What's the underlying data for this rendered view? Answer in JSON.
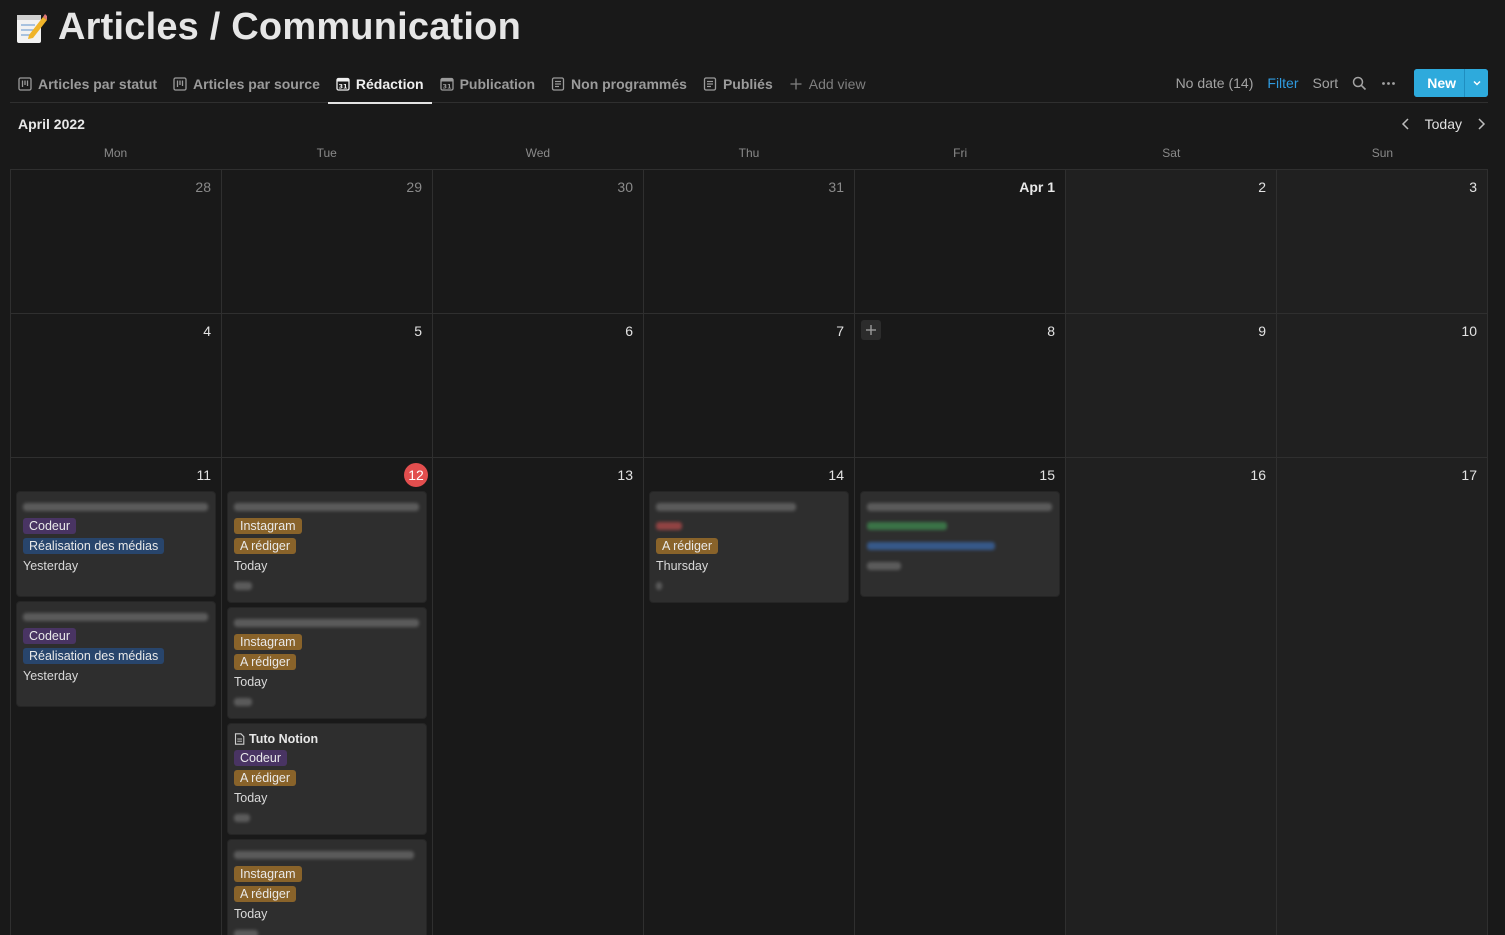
{
  "page": {
    "emoji": "memo-icon",
    "title": "Articles / Communication"
  },
  "views": [
    {
      "label": "Articles par statut",
      "icon": "board-icon",
      "active": false
    },
    {
      "label": "Articles par source",
      "icon": "board-icon",
      "active": false
    },
    {
      "label": "Rédaction",
      "icon": "calendar-icon",
      "active": true
    },
    {
      "label": "Publication",
      "icon": "calendar-icon",
      "active": false
    },
    {
      "label": "Non programmés",
      "icon": "list-icon",
      "active": false
    },
    {
      "label": "Publiés",
      "icon": "list-icon",
      "active": false
    }
  ],
  "add_view_label": "Add view",
  "actions": {
    "no_date": "No date (14)",
    "filter": "Filter",
    "sort": "Sort",
    "new": "New"
  },
  "calendar": {
    "month": "April 2022",
    "today_label": "Today",
    "weekdays": [
      "Mon",
      "Tue",
      "Wed",
      "Thu",
      "Fri",
      "Sat",
      "Sun"
    ],
    "weeks": [
      [
        "28",
        "29",
        "30",
        "31",
        "Apr 1",
        "2",
        "3"
      ],
      [
        "4",
        "5",
        "6",
        "7",
        "8",
        "9",
        "10"
      ],
      [
        "11",
        "12",
        "13",
        "14",
        "15",
        "16",
        "17"
      ]
    ]
  },
  "cards": {
    "mon_1": {
      "tag1": "Codeur",
      "tag2": "Réalisation des médias",
      "date": "Yesterday"
    },
    "mon_2": {
      "tag1": "Codeur",
      "tag2": "Réalisation des médias",
      "date": "Yesterday"
    },
    "tue_1": {
      "tag1": "Instagram",
      "tag2": "A rédiger",
      "date": "Today"
    },
    "tue_2": {
      "tag1": "Instagram",
      "tag2": "A rédiger",
      "date": "Today"
    },
    "tue_3": {
      "title": "Tuto Notion",
      "tag1": "Codeur",
      "tag2": "A rédiger",
      "date": "Today"
    },
    "tue_4": {
      "tag1": "Instagram",
      "tag2": "A rédiger",
      "date": "Today"
    },
    "thu_1": {
      "tag2": "A rédiger",
      "date": "Thursday"
    }
  }
}
